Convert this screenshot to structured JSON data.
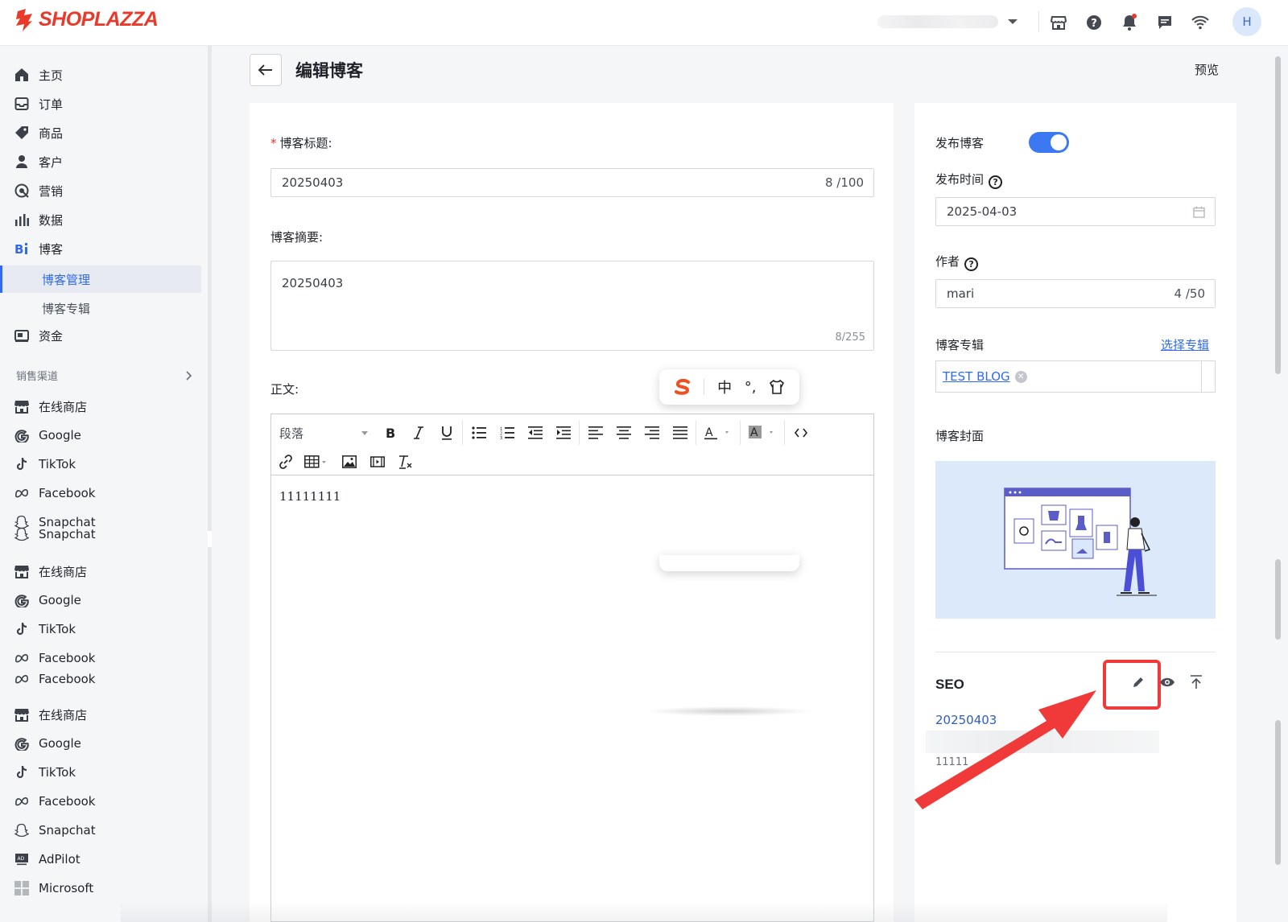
{
  "header": {
    "logo_text": "SHOPLAZZA",
    "avatar_initial": "H",
    "icons": [
      "store-icon",
      "help-icon",
      "bell-icon",
      "chat-icon",
      "wifi-icon"
    ]
  },
  "sidebar": {
    "items": [
      {
        "label": "主页",
        "icon": "home-icon"
      },
      {
        "label": "订单",
        "icon": "inbox-icon"
      },
      {
        "label": "商品",
        "icon": "tag-icon"
      },
      {
        "label": "客户",
        "icon": "user-icon"
      },
      {
        "label": "营销",
        "icon": "target-icon"
      },
      {
        "label": "数据",
        "icon": "bar-chart-icon"
      },
      {
        "label": "博客",
        "icon": "blog-icon"
      }
    ],
    "blog_sub": [
      {
        "label": "博客管理"
      },
      {
        "label": "博客专辑"
      }
    ],
    "funds": {
      "label": "资金",
      "icon": "wallet-icon"
    },
    "channel_heading": "销售渠道",
    "channels": [
      {
        "label": "在线商店",
        "icon": "store-icon"
      },
      {
        "label": "Google",
        "icon": "google-icon"
      },
      {
        "label": "TikTok",
        "icon": "tiktok-icon"
      },
      {
        "label": "Facebook",
        "icon": "meta-icon"
      },
      {
        "label": "Snapchat",
        "icon": "snapchat-icon"
      },
      {
        "label": "Snapchat",
        "icon": "snapchat-icon"
      },
      {
        "label": "在线商店",
        "icon": "store-icon"
      },
      {
        "label": "Google",
        "icon": "google-icon"
      },
      {
        "label": "TikTok",
        "icon": "tiktok-icon"
      },
      {
        "label": "Facebook",
        "icon": "meta-icon"
      },
      {
        "label": "Facebook",
        "icon": "meta-icon"
      },
      {
        "label": "在线商店",
        "icon": "store-icon"
      },
      {
        "label": "Google",
        "icon": "google-icon"
      },
      {
        "label": "TikTok",
        "icon": "tiktok-icon"
      },
      {
        "label": "Facebook",
        "icon": "meta-icon"
      },
      {
        "label": "Snapchat",
        "icon": "snapchat-icon"
      },
      {
        "label": "AdPilot",
        "icon": "adpilot-icon"
      },
      {
        "label": "Microsoft",
        "icon": "microsoft-icon"
      }
    ]
  },
  "page": {
    "title": "编辑博客",
    "preview": "预览"
  },
  "form": {
    "title_label": "博客标题:",
    "title_value": "20250403",
    "title_count": "8 /100",
    "summary_label": "博客摘要:",
    "summary_value": "20250403",
    "summary_count": "8/255",
    "body_label": "正文:",
    "paragraph_select": "段落",
    "body_text": "11111111"
  },
  "ime": {
    "items": [
      "中",
      "°,"
    ]
  },
  "side": {
    "publish_label": "发布博客",
    "publish_on": true,
    "publish_time_label": "发布时间",
    "publish_time_value": "2025-04-03",
    "author_label": "作者",
    "author_value": "mari",
    "author_count": "4 /50",
    "album_label": "博客专辑",
    "album_select": "选择专辑",
    "album_tag": "TEST BLOG",
    "cover_label": "博客封面",
    "seo_title": "SEO",
    "seo_link": "20250403",
    "seo_desc": "11111"
  },
  "colors": {
    "brand": "#e8392b",
    "accent": "#2f6af0",
    "highlight": "#f03a3a"
  }
}
